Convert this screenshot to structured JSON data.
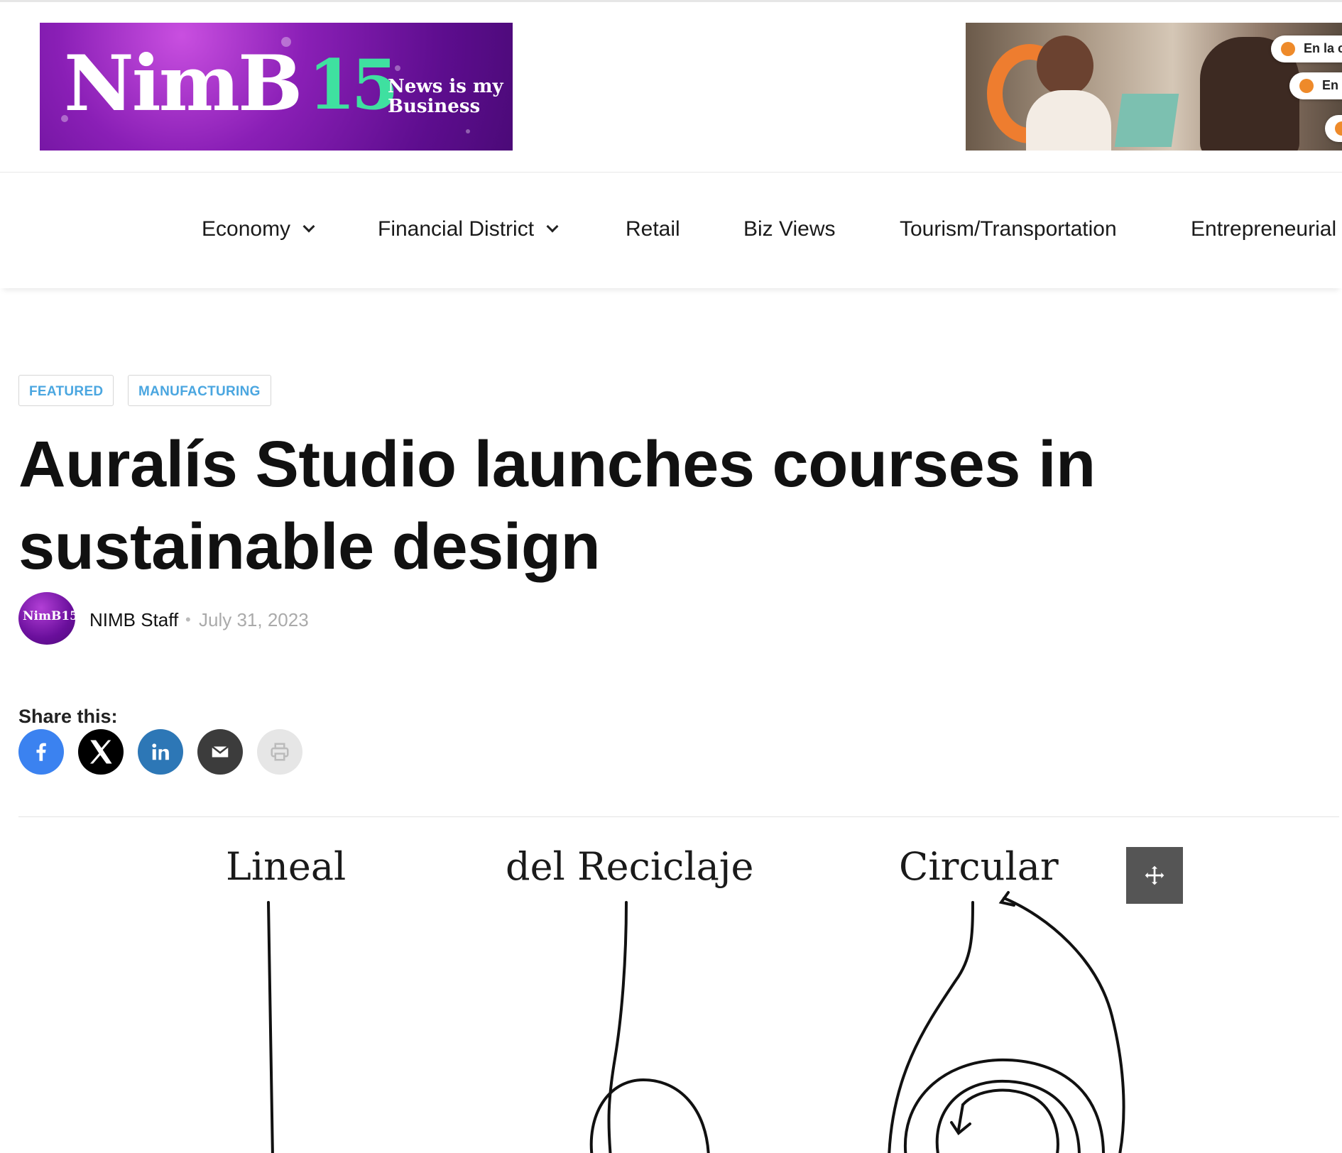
{
  "header": {
    "logo": {
      "brand": "NimB",
      "number": "15",
      "tagline_line1": "News is my",
      "tagline_line2": "Business"
    },
    "ad": {
      "pill1": "En la c",
      "pill2": "En"
    }
  },
  "nav": {
    "items": [
      {
        "label": "Economy",
        "has_dropdown": true
      },
      {
        "label": "Financial District",
        "has_dropdown": true
      },
      {
        "label": "Retail",
        "has_dropdown": false
      },
      {
        "label": "Biz Views",
        "has_dropdown": false
      },
      {
        "label": "Tourism/Transportation",
        "has_dropdown": false
      },
      {
        "label": "Entrepreneurial",
        "has_dropdown": false
      }
    ]
  },
  "article": {
    "categories": [
      "FEATURED",
      "MANUFACTURING"
    ],
    "title": "Auralís Studio launches courses in sustainable design",
    "author": "NIMB Staff",
    "date": "July 31, 2023",
    "avatar_text": "NimB15"
  },
  "share": {
    "label": "Share this:",
    "buttons": [
      {
        "icon": "facebook-icon",
        "color": "#3b82f0"
      },
      {
        "icon": "x-icon",
        "color": "#000000"
      },
      {
        "icon": "linkedin-icon",
        "color": "#2d77b6"
      },
      {
        "icon": "email-icon",
        "color": "#3c3c3c"
      },
      {
        "icon": "print-icon",
        "color": "#e6e6e6"
      }
    ]
  },
  "figure": {
    "labels": [
      "Lineal",
      "del Reciclaje",
      "Circular"
    ]
  },
  "colors": {
    "category_text": "#4aa6e0",
    "brand_purple": "#6a0f9c",
    "brand_green": "#3fe0a0"
  }
}
